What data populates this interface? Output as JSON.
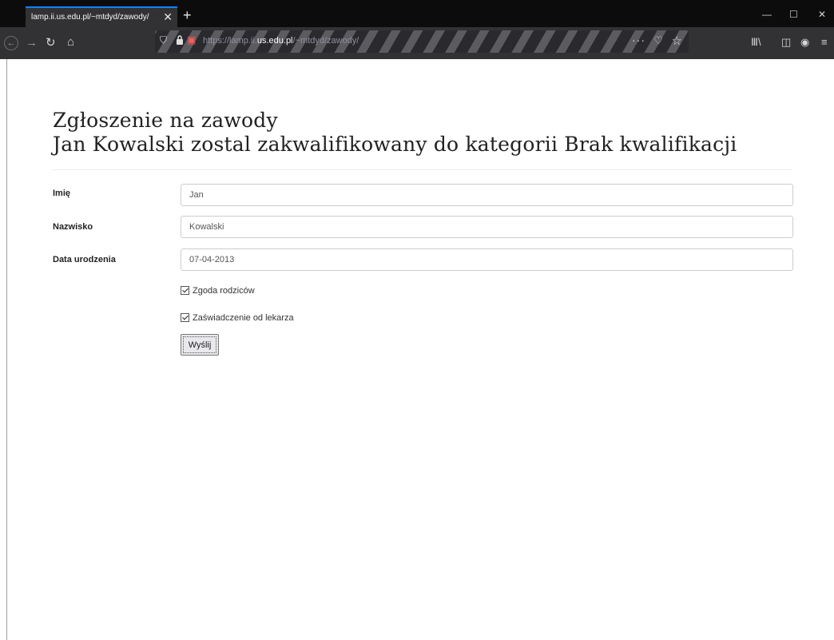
{
  "browser": {
    "tab_title": "lamp.ii.us.edu.pl/~mtdyd/zawody/",
    "url_prefix": "https://lamp.ii.",
    "url_domain": "us.edu.pl",
    "url_suffix": "/~mtdyd/zawody/"
  },
  "page": {
    "heading_line1": "Zgłoszenie na zawody",
    "heading_line2": "Jan Kowalski zostal zakwalifikowany do kategorii Brak kwalifikacji"
  },
  "form": {
    "first_name_label": "Imię",
    "first_name_value": "Jan",
    "last_name_label": "Nazwisko",
    "last_name_value": "Kowalski",
    "birthdate_label": "Data urodzenia",
    "birthdate_value": "07-04-2013",
    "parent_consent_label": "Zgoda rodziców",
    "parent_consent_checked": true,
    "doctor_cert_label": "Zaświadczenie od lekarza",
    "doctor_cert_checked": true,
    "submit_label": "Wyślij"
  }
}
